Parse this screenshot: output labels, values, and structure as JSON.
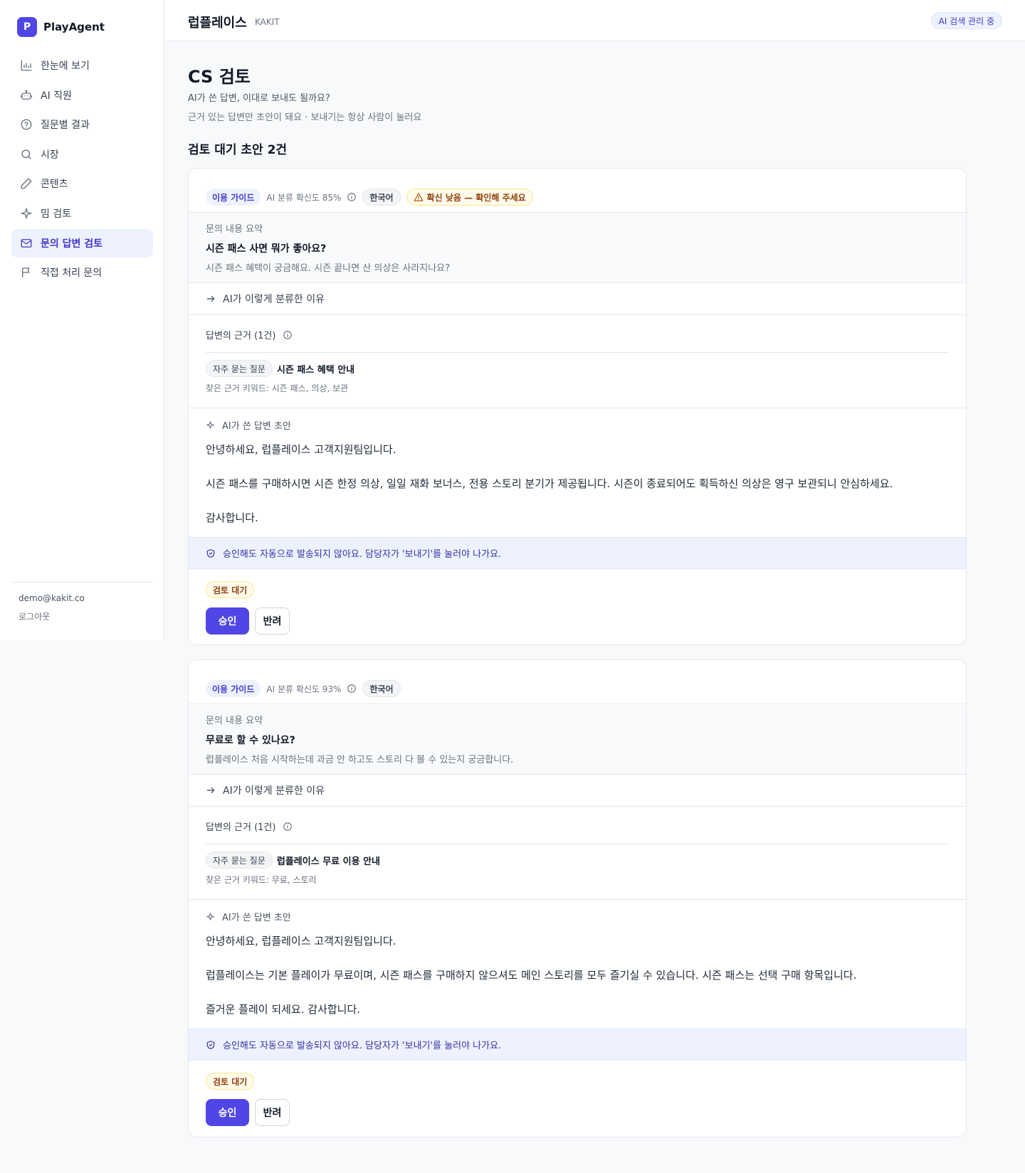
{
  "brand": {
    "logo_letter": "P",
    "name": "PlayAgent"
  },
  "sidebar": {
    "items": [
      {
        "label": "한눈에 보기",
        "icon": "bar-chart-icon"
      },
      {
        "label": "AI 직원",
        "icon": "robot-icon"
      },
      {
        "label": "질문별 결과",
        "icon": "help-circle-icon"
      },
      {
        "label": "시장",
        "icon": "search-icon"
      },
      {
        "label": "콘텐츠",
        "icon": "pencil-icon"
      },
      {
        "label": "밈 검토",
        "icon": "sparkle-icon"
      },
      {
        "label": "문의 답변 검토",
        "icon": "mail-icon",
        "active": true
      },
      {
        "label": "직접 처리 문의",
        "icon": "flag-icon"
      }
    ],
    "user_email": "demo@kakit.co",
    "logout_label": "로그아웃"
  },
  "header": {
    "title": "럽플레이스",
    "subtitle": "KAKIT",
    "status": "AI 검색 관리 중"
  },
  "page": {
    "title": "CS 검토",
    "subtitle": "AI가 쓴 답변, 이대로 보내도 될까요?",
    "note": "근거 있는 답변만 초안이 돼요 · 보내기는 항상 사람이 눌러요",
    "section_title": "검토 대기 초안 2건"
  },
  "cards": [
    {
      "category": "이용 가이드",
      "confidence": "AI 분류 확신도 85%",
      "language": "한국어",
      "warning": "확신 낮음 — 확인해 주세요",
      "summary_label": "문의 내용 요약",
      "question": "시즌 패스 사면 뭐가 좋아요?",
      "detail": "시즌 패스 혜택이 궁금해요. 시즌 끝나면 산 의상은 사라지나요?",
      "why_label": "AI가 이렇게 분류한 이유",
      "evidence_label": "답변의 근거 (1건)",
      "evidence_type": "자주 묻는 질문",
      "evidence_title": "시즌 패스 혜택 안내",
      "evidence_keywords": "찾은 근거 키워드: 시즌 패스, 의상, 보관",
      "draft_label": "AI가 쓴 답변 초안",
      "draft_p1": "안녕하세요, 럽플레이스 고객지원팀입니다.",
      "draft_p2": "시즌 패스를 구매하시면 시즌 한정 의상, 일일 재화 보너스, 전용 스토리 분기가 제공됩니다. 시즌이 종료되어도 획득하신 의상은 영구 보관되니 안심하세요.",
      "draft_p3": "감사합니다.",
      "notice": "승인해도 자동으로 발송되지 않아요. 담당자가 '보내기'를 눌러야 나가요.",
      "status": "검토 대기",
      "approve_label": "승인",
      "reject_label": "반려"
    },
    {
      "category": "이용 가이드",
      "confidence": "AI 분류 확신도 93%",
      "language": "한국어",
      "summary_label": "문의 내용 요약",
      "question": "무료로 할 수 있나요?",
      "detail": "럽플레이스 처음 시작하는데 과금 안 하고도 스토리 다 볼 수 있는지 궁금합니다.",
      "why_label": "AI가 이렇게 분류한 이유",
      "evidence_label": "답변의 근거 (1건)",
      "evidence_type": "자주 묻는 질문",
      "evidence_title": "럽플레이스 무료 이용 안내",
      "evidence_keywords": "찾은 근거 키워드: 무료, 스토리",
      "draft_label": "AI가 쓴 답변 초안",
      "draft_p1": "안녕하세요, 럽플레이스 고객지원팀입니다.",
      "draft_p2": "럽플레이스는 기본 플레이가 무료이며, 시즌 패스를 구매하지 않으셔도 메인 스토리를 모두 즐기실 수 있습니다. 시즌 패스는 선택 구매 항목입니다.",
      "draft_p3": "즐거운 플레이 되세요. 감사합니다.",
      "notice": "승인해도 자동으로 발송되지 않아요. 담당자가 '보내기'를 눌러야 나가요.",
      "status": "검토 대기",
      "approve_label": "승인",
      "reject_label": "반려"
    }
  ],
  "colors": {
    "accent": "#4f46e5",
    "warning_bg": "#fffbeb",
    "warning_text": "#92400e",
    "notice_bg": "#eef2ff"
  }
}
